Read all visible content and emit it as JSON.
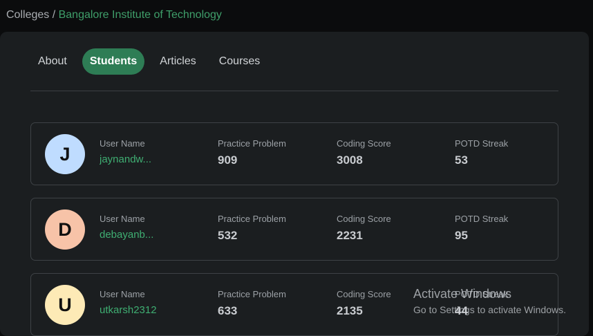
{
  "breadcrumb": {
    "parent": "Colleges",
    "separator": " / ",
    "current": "Bangalore Institute of Technology"
  },
  "tabs": [
    {
      "label": "About",
      "active": false
    },
    {
      "label": "Students",
      "active": true
    },
    {
      "label": "Articles",
      "active": false
    },
    {
      "label": "Courses",
      "active": false
    }
  ],
  "columns": {
    "user": "User Name",
    "practice": "Practice Problem",
    "coding": "Coding Score",
    "potd": "POTD Streak"
  },
  "students": [
    {
      "initial": "J",
      "avatar_color": "#bfdcff",
      "username": "jaynandw...",
      "practice": "909",
      "coding": "3008",
      "potd": "53"
    },
    {
      "initial": "D",
      "avatar_color": "#f7c3a8",
      "username": "debayanb...",
      "practice": "532",
      "coding": "2231",
      "potd": "95"
    },
    {
      "initial": "U",
      "avatar_color": "#fdeab6",
      "username": "utkarsh2312",
      "practice": "633",
      "coding": "2135",
      "potd": "44"
    }
  ],
  "watermark": {
    "title": "Activate Windows",
    "subtitle": "Go to Settings to activate Windows."
  }
}
